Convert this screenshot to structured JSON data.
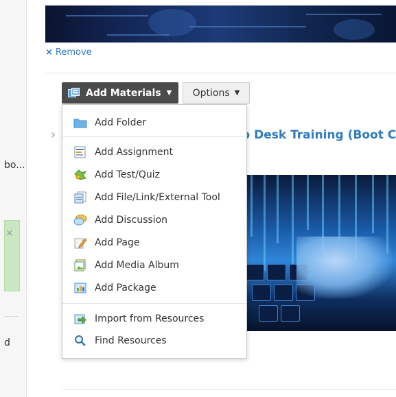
{
  "left_panel": {
    "text_1": "bo...",
    "close_glyph": "×",
    "text_2": "d"
  },
  "attachment": {
    "remove_icon": "×",
    "remove_label": "Remove"
  },
  "toolbar": {
    "add_materials_label": "Add Materials",
    "options_label": "Options",
    "caret_glyph": "▼"
  },
  "content": {
    "chevron_glyph": "›",
    "course_title": "p Desk Training (Boot Can"
  },
  "menu": {
    "items": [
      {
        "label": "Add Folder",
        "icon": "folder-icon"
      },
      {
        "label": "Add Assignment",
        "icon": "assignment-icon"
      },
      {
        "label": "Add Test/Quiz",
        "icon": "test-quiz-icon"
      },
      {
        "label": "Add File/Link/External Tool",
        "icon": "file-link-icon"
      },
      {
        "label": "Add Discussion",
        "icon": "discussion-icon"
      },
      {
        "label": "Add Page",
        "icon": "page-icon"
      },
      {
        "label": "Add Media Album",
        "icon": "media-album-icon"
      },
      {
        "label": "Add Package",
        "icon": "package-icon"
      },
      {
        "label": "Import from Resources",
        "icon": "import-icon"
      },
      {
        "label": "Find Resources",
        "icon": "search-icon"
      }
    ]
  }
}
